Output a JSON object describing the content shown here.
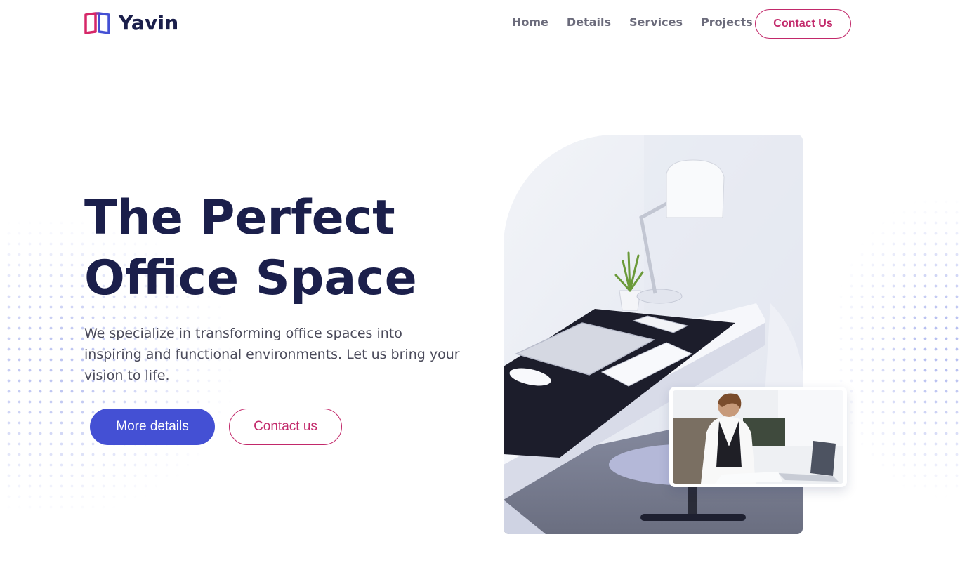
{
  "brand": {
    "name": "Yavin",
    "logo_icon": "book-logo-icon",
    "logo_colors": [
      "#d62768",
      "#4450d4"
    ]
  },
  "nav": {
    "items": [
      {
        "label": "Home"
      },
      {
        "label": "Details"
      },
      {
        "label": "Services"
      },
      {
        "label": "Projects"
      }
    ],
    "contact_label": "Contact Us"
  },
  "hero": {
    "title_line1": "The Perfect",
    "title_line2": "Office Space",
    "subtitle": "We specialize in transforming office spaces into inspiring and functional environments. Let us bring your vision to life.",
    "primary_button": "More details",
    "secondary_button": "Contact us"
  },
  "images": {
    "main": "office-desk-photo",
    "inset": "woman-working-laptop-photo"
  },
  "colors": {
    "primary": "#4450d4",
    "accent": "#c2286a",
    "heading": "#1b1f4b",
    "text": "#4b4b5b",
    "nav_text": "#6b6b7b",
    "dots": "#b7bff0"
  }
}
